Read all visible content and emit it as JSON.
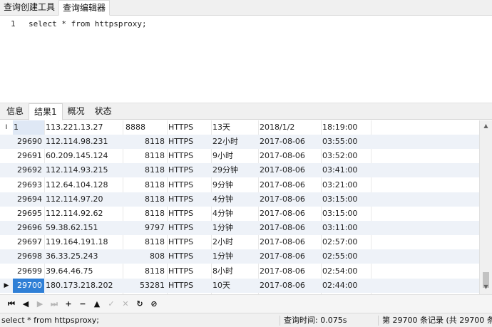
{
  "top_tabs": [
    "查询创建工具",
    "查询编辑器"
  ],
  "editor": {
    "line_number": "1",
    "code": "select * from httpsproxy;"
  },
  "result_tabs": [
    "信息",
    "结果1",
    "概况",
    "状态"
  ],
  "grid": {
    "row_indicator_first": "I",
    "row_indicator_selected": "▶",
    "rows": [
      {
        "id": "1",
        "ip": "113.221.13.27",
        "port": "8888",
        "proto": "HTTPS",
        "time": "13天",
        "date": "2018/1/2",
        "clock": "18:19:00"
      },
      {
        "id": "29690",
        "ip": "112.114.98.231",
        "port": "8118",
        "proto": "HTTPS",
        "time": "22小时",
        "date": "2017-08-06",
        "clock": "03:55:00"
      },
      {
        "id": "29691",
        "ip": "60.209.145.124",
        "port": "8118",
        "proto": "HTTPS",
        "time": "9小时",
        "date": "2017-08-06",
        "clock": "03:52:00"
      },
      {
        "id": "29692",
        "ip": "112.114.93.215",
        "port": "8118",
        "proto": "HTTPS",
        "time": "29分钟",
        "date": "2017-08-06",
        "clock": "03:41:00"
      },
      {
        "id": "29693",
        "ip": "112.64.104.128",
        "port": "8118",
        "proto": "HTTPS",
        "time": "9分钟",
        "date": "2017-08-06",
        "clock": "03:21:00"
      },
      {
        "id": "29694",
        "ip": "112.114.97.20",
        "port": "8118",
        "proto": "HTTPS",
        "time": "4分钟",
        "date": "2017-08-06",
        "clock": "03:15:00"
      },
      {
        "id": "29695",
        "ip": "112.114.92.62",
        "port": "8118",
        "proto": "HTTPS",
        "time": "4分钟",
        "date": "2017-08-06",
        "clock": "03:15:00"
      },
      {
        "id": "29696",
        "ip": "59.38.62.151",
        "port": "9797",
        "proto": "HTTPS",
        "time": "1分钟",
        "date": "2017-08-06",
        "clock": "03:11:00"
      },
      {
        "id": "29697",
        "ip": "119.164.191.18",
        "port": "8118",
        "proto": "HTTPS",
        "time": "2小时",
        "date": "2017-08-06",
        "clock": "02:57:00"
      },
      {
        "id": "29698",
        "ip": "36.33.25.243",
        "port": "808",
        "proto": "HTTPS",
        "time": "1分钟",
        "date": "2017-08-06",
        "clock": "02:55:00"
      },
      {
        "id": "29699",
        "ip": "39.64.46.75",
        "port": "8118",
        "proto": "HTTPS",
        "time": "8小时",
        "date": "2017-08-06",
        "clock": "02:54:00"
      },
      {
        "id": "29700",
        "ip": "180.173.218.202",
        "port": "53281",
        "proto": "HTTPS",
        "time": "10天",
        "date": "2017-08-06",
        "clock": "02:44:00"
      }
    ]
  },
  "scrollbar": {
    "up_icon": "▲",
    "down_icon": "▼"
  },
  "navigator": {
    "buttons": [
      {
        "name": "first-record-button",
        "glyph": "⏮",
        "enabled": true
      },
      {
        "name": "previous-record-button",
        "glyph": "◀",
        "enabled": true
      },
      {
        "name": "next-record-button",
        "glyph": "▶",
        "enabled": false
      },
      {
        "name": "last-record-button",
        "glyph": "⏭",
        "enabled": false
      },
      {
        "name": "add-record-button",
        "glyph": "+",
        "enabled": true
      },
      {
        "name": "delete-record-button",
        "glyph": "−",
        "enabled": true
      },
      {
        "name": "up-button",
        "glyph": "▲",
        "enabled": true
      },
      {
        "name": "apply-button",
        "glyph": "✓",
        "enabled": false
      },
      {
        "name": "discard-button",
        "glyph": "✕",
        "enabled": false
      },
      {
        "name": "refresh-button",
        "glyph": "↻",
        "enabled": true
      },
      {
        "name": "stop-button",
        "glyph": "⊘",
        "enabled": true
      }
    ]
  },
  "status_bar": {
    "query": "select * from httpsproxy;",
    "query_time": "查询时间: 0.075s",
    "record_info": "第 29700 条记录 (共 29700 条"
  },
  "colors": {
    "selected_cell": "#2f7fd6",
    "alt_row": "#eef2f8"
  }
}
